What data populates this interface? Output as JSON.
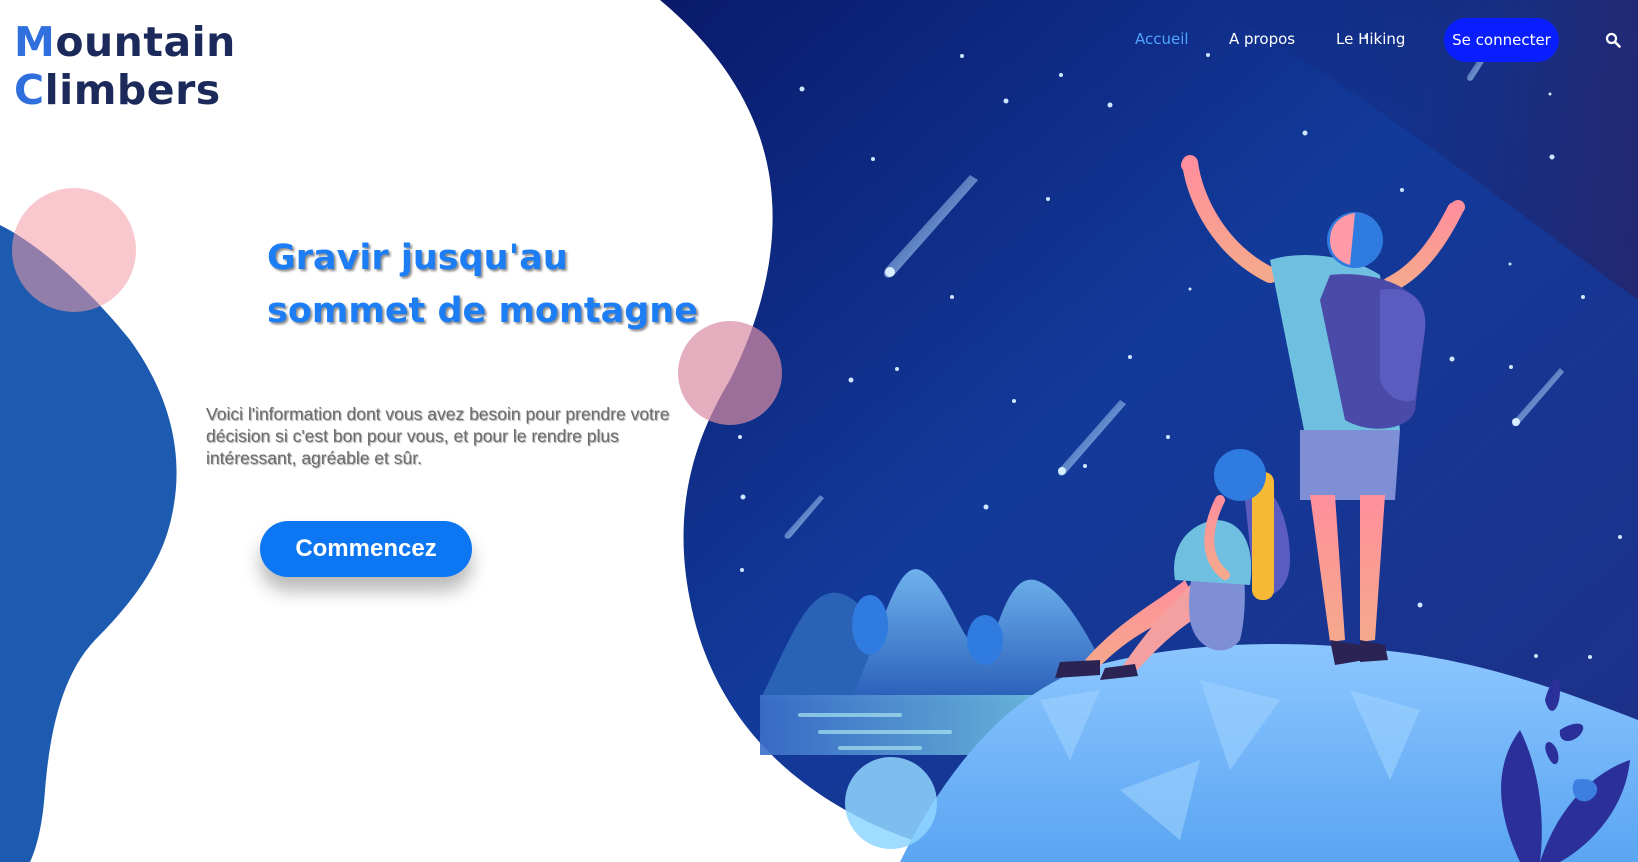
{
  "brand": {
    "line1_initial": "M",
    "line1_rest": "ountain",
    "line2_initial": "C",
    "line2_rest": "limbers"
  },
  "nav": {
    "items": [
      {
        "label": "Accueil",
        "active": true
      },
      {
        "label": "A propos",
        "active": false
      },
      {
        "label": "Le Hiking",
        "active": false
      }
    ],
    "login_label": "Se connecter",
    "search_icon": "search-icon"
  },
  "hero": {
    "headline_line1": "Gravir jusqu'au",
    "headline_line2": "sommet de montagne",
    "description": "Voici l'information dont vous avez besoin pour prendre votre décision si c'est bon pour vous, et pour le rendre plus intéressant, agréable et sûr.",
    "cta_label": "Commencez"
  },
  "colors": {
    "brand_dark": "#1b2a5b",
    "brand_accent": "#2f6fde",
    "headline": "#1c7df5",
    "cta": "#0d76f2",
    "login_button": "#0a1fff",
    "nav_active": "#4fa3ff",
    "sky_dark": "#0b1f6e",
    "left_blob": "#1d5bb0",
    "pink_circle": "#f29aa6"
  }
}
